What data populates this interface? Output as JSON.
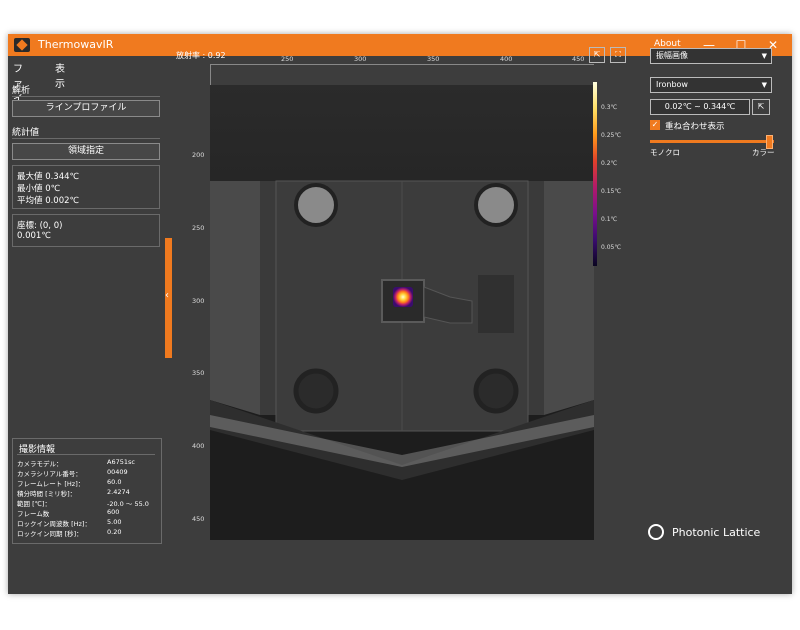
{
  "window": {
    "title": "ThermowavIR",
    "about": "About",
    "controls": [
      "—",
      "☐",
      "✕"
    ]
  },
  "menubar": {
    "items": [
      "ファイル",
      "表示"
    ]
  },
  "left": {
    "analysis": {
      "title": "解析",
      "line_profile_button": "ラインプロファイル"
    },
    "stats": {
      "title": "統計値",
      "region_button": "領域指定",
      "max": "最大値  0.344℃",
      "min": "最小値  0℃",
      "avg": "平均値  0.002℃"
    },
    "coord": {
      "label": "座標: (0, 0)",
      "value": "0.001℃"
    },
    "info": {
      "title": "撮影情報",
      "rows": [
        {
          "k": "カメラモデル：",
          "v": "A6751sc"
        },
        {
          "k": "カメラシリアル番号：",
          "v": "00409"
        },
        {
          "k": "フレームレート [Hz]：",
          "v": "60.0"
        },
        {
          "k": "積分時間 [ミリ秒]：",
          "v": "2.4274"
        },
        {
          "k": "範囲 [℃]：",
          "v": "-20.0 ～ 55.0"
        },
        {
          "k": "フレーム数",
          "v": "600"
        },
        {
          "k": "ロックイン周波数 [Hz]：",
          "v": "5.00"
        },
        {
          "k": "ロックイン同期 [秒]：",
          "v": "0.20"
        }
      ]
    },
    "collapse_icon": "‹"
  },
  "viewer": {
    "emissivity": "放射率 :  0.92",
    "top_ticks": [
      "250",
      "300",
      "350",
      "400",
      "450"
    ],
    "left_ticks": [
      "200",
      "250",
      "300",
      "350",
      "400",
      "450"
    ],
    "colorbar_labels": [
      "0.3℃",
      "0.25℃",
      "0.2℃",
      "0.15℃",
      "0.1℃",
      "0.05℃"
    ],
    "export_icon": "⇱",
    "fit_icon": "⛶"
  },
  "right": {
    "mode_select": "振幅画像",
    "palette_select": "Ironbow",
    "range": "0.02℃ ~ 0.344℃",
    "range_icon": "⇱",
    "overlay_label": "重ね合わせ表示",
    "overlay_checked": "✓",
    "slider_left": "モノクロ",
    "slider_right": "カラー",
    "slider_value": 1.0,
    "brand": "Photonic Lattice"
  },
  "colors": {
    "accent": "#f07a1f",
    "panel": "#3d3d3d"
  }
}
